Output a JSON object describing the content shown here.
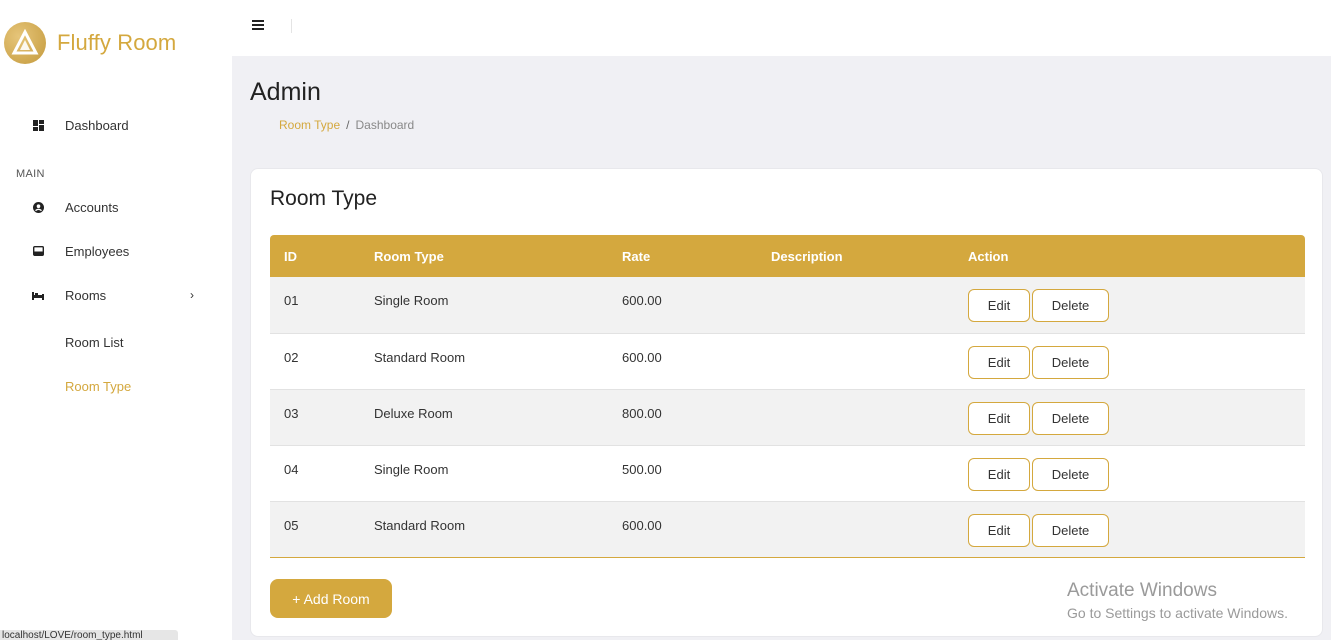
{
  "brand": {
    "name": "Fluffy Room"
  },
  "sidebar": {
    "dashboard": {
      "label": "Dashboard",
      "icon": "dashboard-icon"
    },
    "section_main": "MAIN",
    "accounts": {
      "label": "Accounts",
      "icon": "user-circle-icon"
    },
    "employees": {
      "label": "Employees",
      "icon": "inbox-icon"
    },
    "rooms": {
      "label": "Rooms",
      "icon": "bed-icon",
      "chevron": "›"
    },
    "room_list": "Room List",
    "room_type": "Room Type"
  },
  "header": {
    "title": "Admin",
    "breadcrumb": {
      "link": "Room Type",
      "separator": "/",
      "current": "Dashboard"
    }
  },
  "card": {
    "title": "Room Type",
    "columns": [
      "ID",
      "Room Type",
      "Rate",
      "Description",
      "Action"
    ],
    "rows": [
      {
        "id": "01",
        "room_type": "Single Room",
        "rate": "600.00",
        "description": ""
      },
      {
        "id": "02",
        "room_type": "Standard Room",
        "rate": "600.00",
        "description": ""
      },
      {
        "id": "03",
        "room_type": "Deluxe Room",
        "rate": "800.00",
        "description": ""
      },
      {
        "id": "04",
        "room_type": "Single Room",
        "rate": "500.00",
        "description": ""
      },
      {
        "id": "05",
        "room_type": "Standard Room",
        "rate": "600.00",
        "description": ""
      }
    ],
    "edit_label": "Edit",
    "delete_label": "Delete",
    "add_label": "+ Add Room"
  },
  "watermark": {
    "line1": "Activate Windows",
    "line2": "Go to Settings to activate Windows."
  },
  "status_bar": {
    "url": "localhost/LOVE/room_type.html"
  },
  "colors": {
    "accent": "#d4a83e"
  }
}
